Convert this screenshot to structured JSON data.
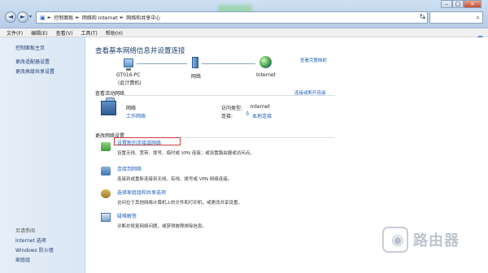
{
  "address_bar": {
    "crumbs": [
      "控制面板",
      "网络和 Internet",
      "网络和共享中心"
    ],
    "separator": "►"
  },
  "menu": [
    "文件(F)",
    "编辑(E)",
    "查看(V)",
    "工具(T)",
    "帮助(H)"
  ],
  "sidebar": {
    "top_links": [
      "控制面板主页",
      "更改适配器设置",
      "更改高级共享设置"
    ],
    "see_also_heading": "另请参阅",
    "see_also_links": [
      "Internet 选项",
      "Windows 防火墙",
      "家庭组"
    ]
  },
  "main": {
    "title": "查看基本网络信息并设置连接",
    "view_full_map": "查看完整映射",
    "map": {
      "computer_name": "GT016-PC",
      "computer_sub": "(此计算机)",
      "network": "网络",
      "internet": "Internet"
    },
    "active_networks": {
      "heading": "查看活动网络",
      "connect_disconnect": "连接或断开连接",
      "network_name": "网络",
      "network_type": "工作网络",
      "access_type_label": "访问类型:",
      "access_type_value": "Internet",
      "connections_label": "连接:",
      "connections_value": "本地连接"
    },
    "change_settings_heading": "更改网络设置",
    "tasks": [
      {
        "title": "设置新的连接或网络",
        "desc": "设置无线、宽带、拨号、临时或 VPN 连接；或设置路由器或访问点。"
      },
      {
        "title": "连接到网络",
        "desc": "连接到或重新连接到无线、有线、拨号或 VPN 网络连接。"
      },
      {
        "title": "选择家庭组和共享选项",
        "desc": "访问位于其他网络计算机上的文件和打印机，或更改共享设置。"
      },
      {
        "title": "疑难解答",
        "desc": "诊断并修复网络问题，或获得故障排除信息。"
      }
    ]
  },
  "watermark": "路由器",
  "colors": {
    "link": "#1e5fb8",
    "title": "#1e3f72",
    "highlight": "#d23b3b"
  }
}
